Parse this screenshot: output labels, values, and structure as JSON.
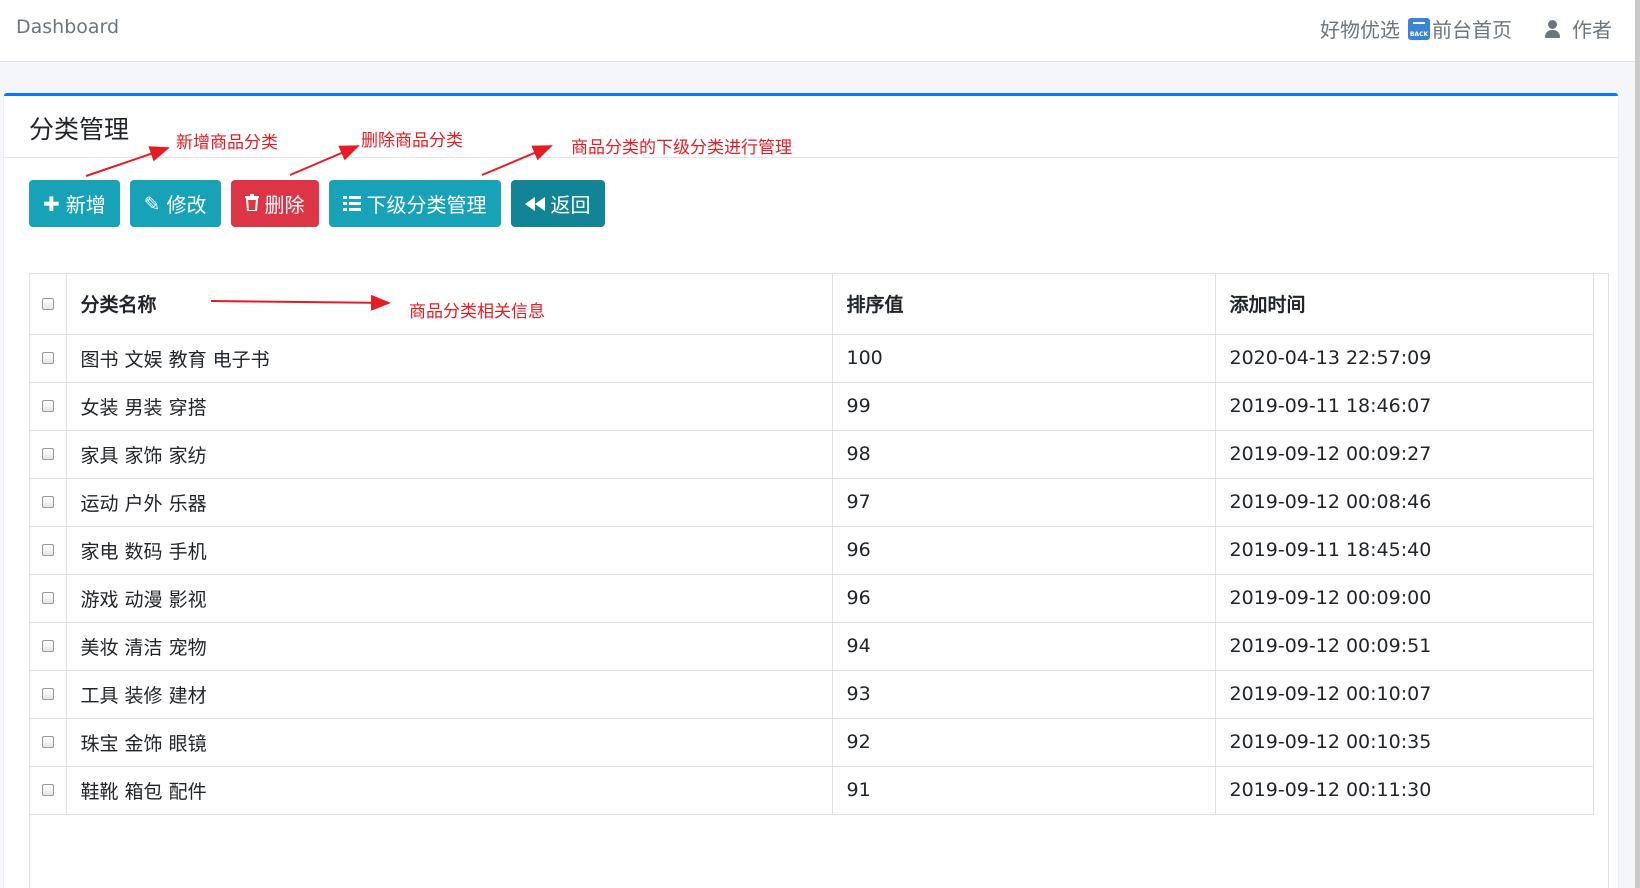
{
  "navbar": {
    "brand": "Dashboard",
    "links": [
      "好物优选",
      "前台首页",
      "作者"
    ],
    "back_icon_text": "BACK"
  },
  "card": {
    "title": "分类管理"
  },
  "annotations": {
    "add": "新增商品分类",
    "delete": "删除商品分类",
    "sub": "商品分类的下级分类进行管理",
    "table": "商品分类相关信息"
  },
  "toolbar": {
    "add": "新增",
    "edit": "修改",
    "delete": "删除",
    "sub": "下级分类管理",
    "back": "返回"
  },
  "table": {
    "headers": [
      "分类名称",
      "排序值",
      "添加时间"
    ],
    "rows": [
      {
        "name": "图书 文娱 教育 电子书",
        "sort": "100",
        "time": "2020-04-13 22:57:09"
      },
      {
        "name": "女装 男装 穿搭",
        "sort": "99",
        "time": "2019-09-11 18:46:07"
      },
      {
        "name": "家具 家饰 家纺",
        "sort": "98",
        "time": "2019-09-12 00:09:27"
      },
      {
        "name": "运动 户外 乐器",
        "sort": "97",
        "time": "2019-09-12 00:08:46"
      },
      {
        "name": "家电 数码 手机",
        "sort": "96",
        "time": "2019-09-11 18:45:40"
      },
      {
        "name": "游戏 动漫 影视",
        "sort": "96",
        "time": "2019-09-12 00:09:00"
      },
      {
        "name": "美妆 清洁 宠物",
        "sort": "94",
        "time": "2019-09-12 00:09:51"
      },
      {
        "name": "工具 装修 建材",
        "sort": "93",
        "time": "2019-09-12 00:10:07"
      },
      {
        "name": "珠宝 金饰 眼镜",
        "sort": "92",
        "time": "2019-09-12 00:10:35"
      },
      {
        "name": "鞋靴 箱包 配件",
        "sort": "91",
        "time": "2019-09-12 00:11:30"
      }
    ]
  },
  "colors": {
    "info": "#17a2b8",
    "danger": "#dc3545",
    "primary": "#007bff",
    "annotation": "#e51c23"
  }
}
